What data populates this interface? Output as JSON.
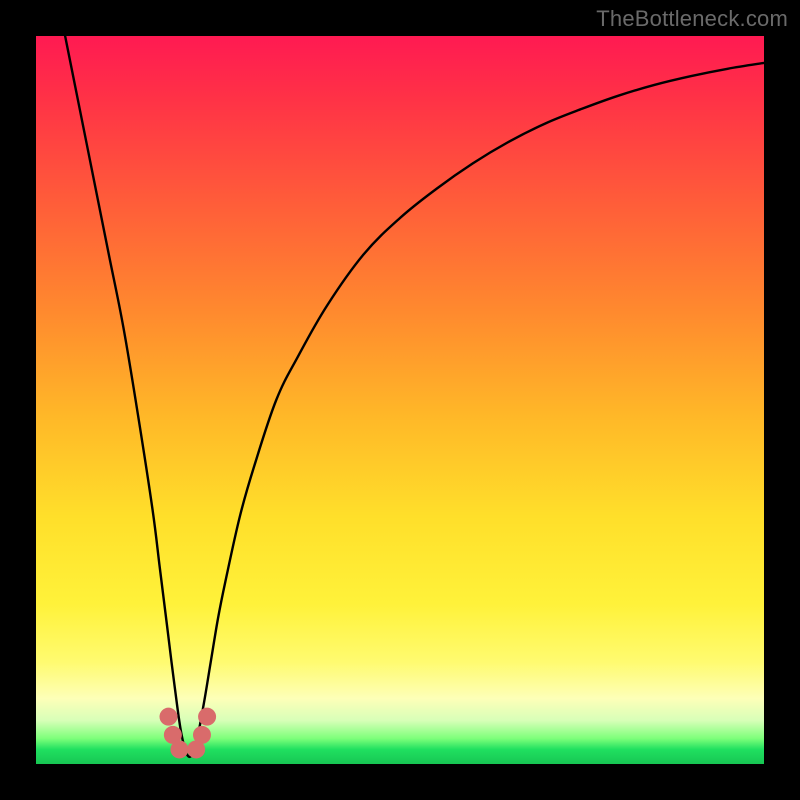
{
  "watermark": "TheBottleneck.com",
  "colors": {
    "frame": "#000000",
    "curve": "#000000",
    "marker": "#d96b6b",
    "gradient_top": "#ff1a52",
    "gradient_bottom": "#17c653"
  },
  "chart_data": {
    "type": "line",
    "title": "",
    "xlabel": "",
    "ylabel": "",
    "xlim": [
      0,
      100
    ],
    "ylim": [
      0,
      100
    ],
    "notch_x": 21,
    "series": [
      {
        "name": "bottleneck-curve",
        "x": [
          4,
          6,
          8,
          10,
          12,
          14,
          16,
          17,
          18,
          19,
          20,
          21,
          22,
          23,
          24,
          25,
          26,
          28,
          30,
          33,
          36,
          40,
          45,
          50,
          55,
          60,
          65,
          70,
          75,
          80,
          85,
          90,
          95,
          100
        ],
        "y": [
          100,
          90,
          80,
          70,
          60,
          48,
          35,
          27,
          19,
          11,
          4,
          1,
          3,
          8,
          14,
          20,
          25,
          34,
          41,
          50,
          56,
          63,
          70,
          75,
          79,
          82.5,
          85.5,
          88,
          90,
          91.8,
          93.3,
          94.5,
          95.5,
          96.3
        ]
      }
    ],
    "markers": [
      {
        "x": 18.2,
        "y": 6.5
      },
      {
        "x": 18.8,
        "y": 4.0
      },
      {
        "x": 19.7,
        "y": 2.0
      },
      {
        "x": 22.0,
        "y": 2.0
      },
      {
        "x": 22.8,
        "y": 4.0
      },
      {
        "x": 23.5,
        "y": 6.5
      }
    ]
  }
}
